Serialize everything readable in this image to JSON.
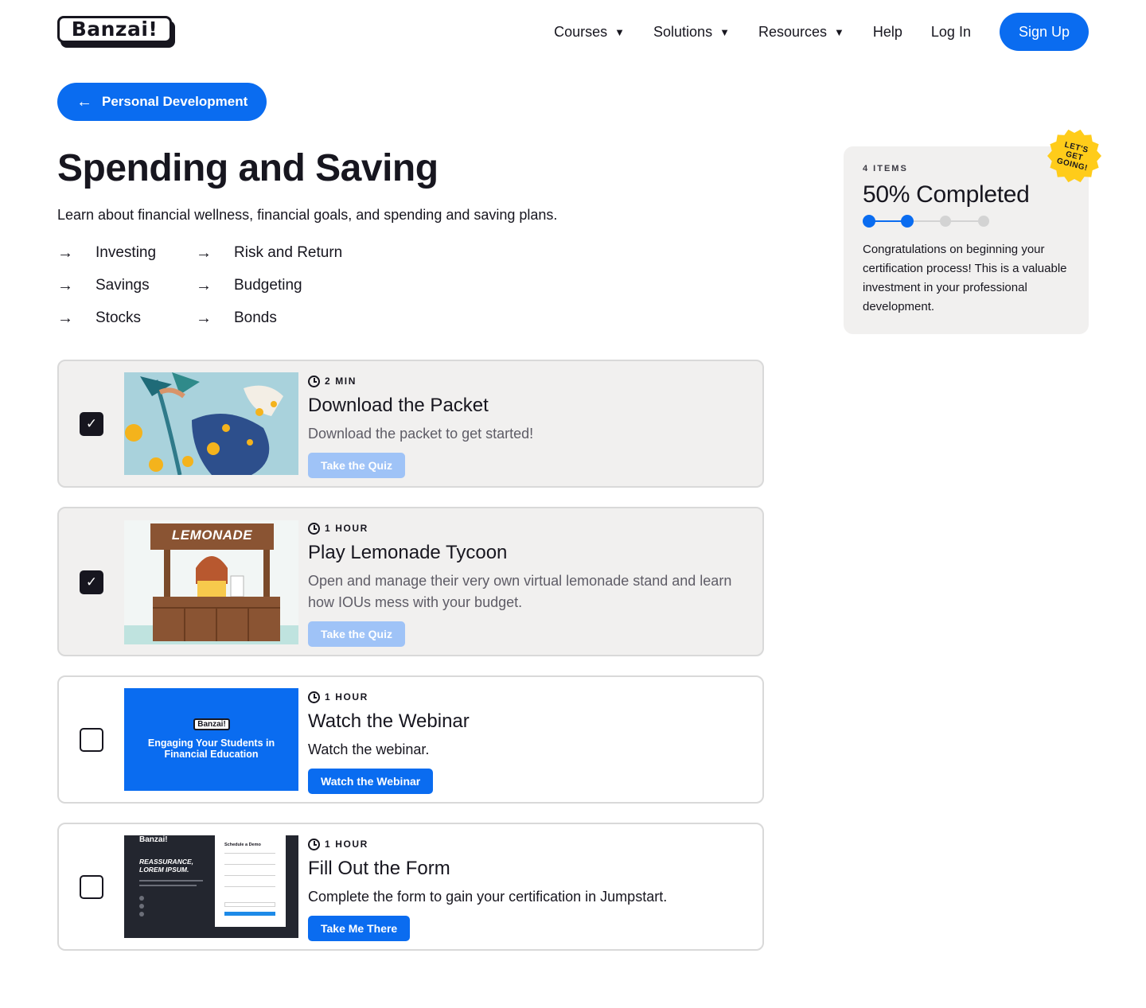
{
  "brand": {
    "logo_text": "Banzai!"
  },
  "nav": {
    "items": [
      {
        "label": "Courses",
        "dropdown": true
      },
      {
        "label": "Solutions",
        "dropdown": true
      },
      {
        "label": "Resources",
        "dropdown": true
      }
    ],
    "help": "Help",
    "login": "Log In",
    "signup": "Sign Up"
  },
  "back_link": {
    "label": "Personal Development",
    "icon": "arrow-left-icon"
  },
  "course": {
    "title": "Spending and Saving",
    "description": "Learn about financial wellness, financial goals, and spending and saving plans.",
    "topics": [
      "Investing",
      "Risk and Return",
      "Savings",
      "Budgeting",
      "Stocks",
      "Bonds"
    ]
  },
  "lessons": [
    {
      "completed": true,
      "duration": "2 MIN",
      "title": "Download the Packet",
      "description": "Download the packet to get started!",
      "button": "Take the Quiz"
    },
    {
      "completed": true,
      "duration": "1 HOUR",
      "title": "Play Lemonade Tycoon",
      "description": "Open and manage their very own virtual lemonade stand and learn how IOUs mess with  your budget.",
      "button": "Take the Quiz",
      "thumb_sign": "LEMONADE"
    },
    {
      "completed": false,
      "duration": "1 HOUR",
      "title": "Watch the Webinar",
      "description": "Watch the webinar.",
      "button": "Watch the Webinar",
      "thumb_logo": "Banzai!",
      "thumb_text": "Engaging Your Students in Financial Education"
    },
    {
      "completed": false,
      "duration": "1 HOUR",
      "title": "Fill Out the Form",
      "description": "Complete the form to gain your certification in Jumpstart.",
      "button": "Take Me There",
      "thumb_logo": "Banzai!",
      "thumb_heading": "REASSURANCE, LOREM IPSUM.",
      "thumb_form_title": "Schedule a Demo"
    }
  ],
  "progress": {
    "items_label": "4 ITEMS",
    "completed_label": "50% Completed",
    "steps_total": 4,
    "steps_done": 2,
    "message": "Congratulations on beginning your certification process!  This is a valuable investment in your professional development.",
    "badge": [
      "LET'S",
      "GET",
      "GOING!"
    ]
  },
  "colors": {
    "accent": "#0a6cf0",
    "accent_faded": "#9fc3f7",
    "text": "#17161f",
    "card_done_bg": "#f1f0ef",
    "badge": "#ffcc1a"
  }
}
